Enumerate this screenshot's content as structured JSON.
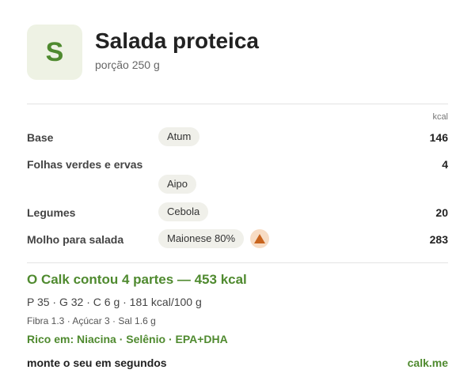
{
  "header": {
    "avatar_letter": "S",
    "title": "Salada proteica",
    "subtitle": "porção 250 g"
  },
  "table": {
    "kcal_header": "kcal",
    "rows": [
      {
        "label": "Base",
        "chips": [
          "Atum"
        ],
        "kcal": "146"
      },
      {
        "label": "Folhas verdes e ervas",
        "chips": [],
        "kcal": "4"
      },
      {
        "label": "",
        "chips": [
          "Aipo"
        ],
        "kcal": ""
      },
      {
        "label": "Legumes",
        "chips": [
          "Cebola"
        ],
        "kcal": "20"
      },
      {
        "label": "Molho para salada",
        "chips": [
          "Maionese 80%"
        ],
        "kcal": "283",
        "warning_icon": "warning-triangle-icon"
      }
    ]
  },
  "summary": {
    "headline": "O Calk contou 4 partes — 453 kcal",
    "macros": "P 35 · G 32 · C 6 g   ·   181 kcal/100 g",
    "micros": "Fibra 1.3 · Açúcar 3 · Sal 1.6 g",
    "rich_in": "Rico em: Niacina · Selênio · EPA+DHA"
  },
  "footer": {
    "cta": "monte o seu em segundos",
    "link": "calk.me"
  },
  "colors": {
    "accent_green": "#4f8a2f",
    "avatar_bg": "#eef2e4",
    "chip_bg": "#f0f0ea",
    "warning_bg": "#f7dcc4",
    "warning_fg": "#c8641e"
  }
}
